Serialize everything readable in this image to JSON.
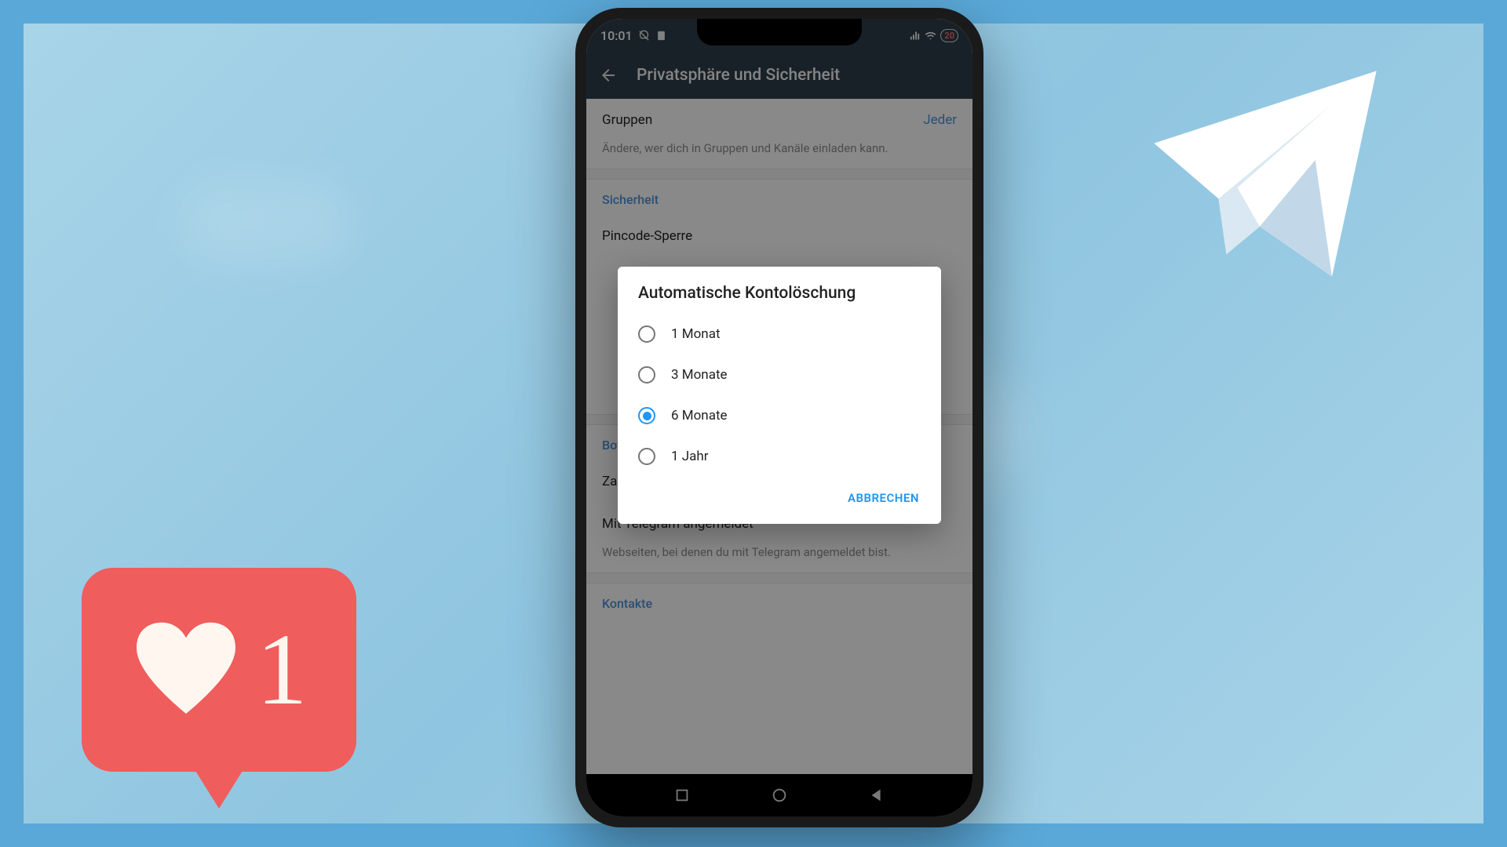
{
  "status": {
    "time": "10:01",
    "battery": "20"
  },
  "header": {
    "title": "Privatsphäre und Sicherheit"
  },
  "groups": {
    "label": "Gruppen",
    "value": "Jeder",
    "hint": "Ändere, wer dich in Gruppen und Kanäle einladen kann."
  },
  "security": {
    "header": "Sicherheit",
    "pincode": "Pincode-Sperre"
  },
  "bots": {
    "header": "Bots und Webseiten",
    "payment": "Zahlungsinfo entfernen",
    "loggedin": "Mit Telegram angemeldet",
    "hint": "Webseiten, bei denen du mit Telegram angemeldet bist."
  },
  "contacts": {
    "header": "Kontakte"
  },
  "dialog": {
    "title": "Automatische Kontolöschung",
    "options": [
      {
        "label": "1 Monat",
        "selected": false
      },
      {
        "label": "3 Monate",
        "selected": false
      },
      {
        "label": "6 Monate",
        "selected": true
      },
      {
        "label": "1 Jahr",
        "selected": false
      }
    ],
    "cancel": "ABBRECHEN"
  },
  "like": {
    "count": "1"
  }
}
